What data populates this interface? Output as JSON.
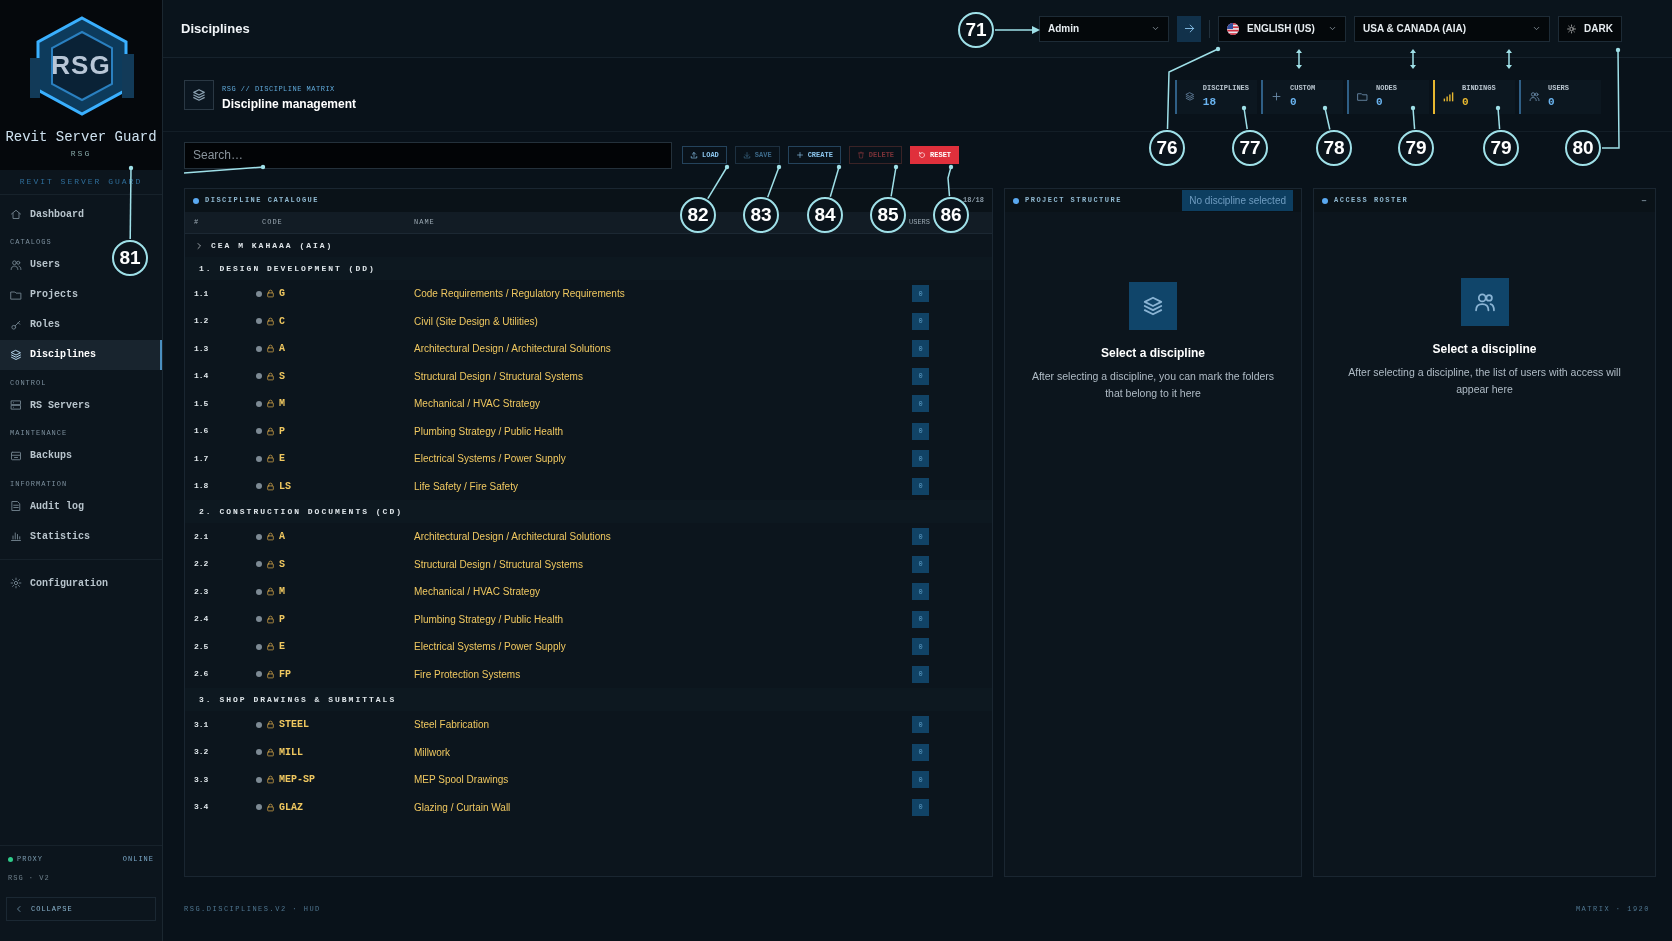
{
  "sidebar": {
    "logo": {
      "mark": "RSG",
      "title": "Revit Server Guard",
      "subtitle": "RSG"
    },
    "brand": "REVIT SERVER GUARD",
    "sections": [
      {
        "items": [
          {
            "label": "Dashboard",
            "selected": false
          }
        ]
      },
      {
        "heading": "CATALOGS",
        "items": [
          {
            "label": "Users",
            "selected": false
          },
          {
            "label": "Projects",
            "selected": false
          },
          {
            "label": "Roles",
            "selected": false
          },
          {
            "label": "Disciplines",
            "selected": true
          }
        ]
      },
      {
        "heading": "CONTROL",
        "items": [
          {
            "label": "RS Servers",
            "selected": false
          }
        ]
      },
      {
        "heading": "MAINTENANCE",
        "items": [
          {
            "label": "Backups",
            "selected": false
          }
        ]
      },
      {
        "heading": "INFORMATION",
        "items": [
          {
            "label": "Audit log",
            "selected": false
          },
          {
            "label": "Statistics",
            "selected": false
          }
        ]
      },
      {
        "items": [
          {
            "label": "Configuration",
            "selected": false
          }
        ]
      }
    ],
    "status": {
      "label": "PROXY",
      "value": "ONLINE",
      "online": true
    },
    "version": "RSG · V2",
    "collapse": "COLLAPSE"
  },
  "header": {
    "title": "Disciplines",
    "user_select": "Admin",
    "language": "ENGLISH (US)",
    "region": "USA & CANADA (AIA)",
    "theme": "DARK"
  },
  "page": {
    "breadcrumb": "RSG // DISCIPLINE MATRIX",
    "title": "Discipline management",
    "stats": [
      {
        "label": "DISCIPLINES",
        "value": "18",
        "color": "#6ab4f0"
      },
      {
        "label": "CUSTOM",
        "value": "0",
        "color": "#6ab4f0"
      },
      {
        "label": "NODES",
        "value": "0",
        "color": "#6ab4f0"
      },
      {
        "label": "BINDINGS",
        "value": "0",
        "color": "#e8b830"
      },
      {
        "label": "USERS",
        "value": "0",
        "color": "#6ab4f0"
      }
    ]
  },
  "toolbar": {
    "search": {
      "placeholder": "Search…"
    },
    "buttons": [
      {
        "label": "LOAD",
        "kind": "outline",
        "disabled": false
      },
      {
        "label": "SAVE",
        "kind": "outline",
        "disabled": true
      },
      {
        "label": "CREATE",
        "kind": "outline",
        "disabled": false
      },
      {
        "label": "DELETE",
        "kind": "danger",
        "disabled": true
      },
      {
        "label": "RESET",
        "kind": "danger-solid",
        "disabled": false
      }
    ]
  },
  "catalogue": {
    "title": "DISCIPLINE CATALOGUE",
    "count": "18/18",
    "columns": [
      "#",
      "CODE",
      "NAME",
      "USERS"
    ],
    "tree": [
      {
        "label": "CEA M KAHAAA (AIA)",
        "children": [
          {
            "label": "1. DESIGN DEVELOPMENT (DD)",
            "children": [
              {
                "number": "1.1",
                "code": "G",
                "name": "Code Requirements / Regulatory Requirements",
                "users": "0"
              },
              {
                "number": "1.2",
                "code": "C",
                "name": "Civil (Site Design & Utilities)",
                "users": "0"
              },
              {
                "number": "1.3",
                "code": "A",
                "name": "Architectural Design / Architectural Solutions",
                "users": "0"
              },
              {
                "number": "1.4",
                "code": "S",
                "name": "Structural Design / Structural Systems",
                "users": "0"
              },
              {
                "number": "1.5",
                "code": "M",
                "name": "Mechanical / HVAC Strategy",
                "users": "0"
              },
              {
                "number": "1.6",
                "code": "P",
                "name": "Plumbing Strategy / Public Health",
                "users": "0"
              },
              {
                "number": "1.7",
                "code": "E",
                "name": "Electrical Systems / Power Supply",
                "users": "0"
              },
              {
                "number": "1.8",
                "code": "LS",
                "name": "Life Safety / Fire Safety",
                "users": "0"
              }
            ]
          },
          {
            "label": "2. CONSTRUCTION DOCUMENTS (CD)",
            "children": [
              {
                "number": "2.1",
                "code": "A",
                "name": "Architectural Design / Architectural Solutions",
                "users": "0"
              },
              {
                "number": "2.2",
                "code": "S",
                "name": "Structural Design / Structural Systems",
                "users": "0"
              },
              {
                "number": "2.3",
                "code": "M",
                "name": "Mechanical / HVAC Strategy",
                "users": "0"
              },
              {
                "number": "2.4",
                "code": "P",
                "name": "Plumbing Strategy / Public Health",
                "users": "0"
              },
              {
                "number": "2.5",
                "code": "E",
                "name": "Electrical Systems / Power Supply",
                "users": "0"
              },
              {
                "number": "2.6",
                "code": "FP",
                "name": "Fire Protection Systems",
                "users": "0"
              }
            ]
          },
          {
            "label": "3. SHOP DRAWINGS & SUBMITTALS",
            "children": [
              {
                "number": "3.1",
                "code": "STEEL",
                "name": "Steel Fabrication",
                "users": "0"
              },
              {
                "number": "3.2",
                "code": "MILL",
                "name": "Millwork",
                "users": "0"
              },
              {
                "number": "3.3",
                "code": "MEP-SP",
                "name": "MEP Spool Drawings",
                "users": "0"
              },
              {
                "number": "3.4",
                "code": "GLAZ",
                "name": "Glazing / Curtain Wall",
                "users": "0"
              }
            ]
          }
        ]
      }
    ]
  },
  "project_structure": {
    "title": "PROJECT STRUCTURE",
    "badge": "No discipline selected",
    "empty_title": "Select a discipline",
    "empty_text": "After selecting a discipline, you can mark the folders that belong to it here"
  },
  "access_roster": {
    "title": "ACCESS ROSTER",
    "action": "–",
    "empty_title": "Select a discipline",
    "empty_text": "After selecting a discipline, the list of users with access will appear here"
  },
  "footer": {
    "left": "RSG.DISCIPLINES.V2 · HUD",
    "right": "MATRIX · 1920"
  },
  "callouts": [
    {
      "label": "71"
    },
    {
      "label": "76"
    },
    {
      "label": "77"
    },
    {
      "label": "78"
    },
    {
      "label": "79"
    },
    {
      "label": "79"
    },
    {
      "label": "80"
    },
    {
      "label": "81"
    },
    {
      "label": "82"
    },
    {
      "label": "83"
    },
    {
      "label": "84"
    },
    {
      "label": "85"
    },
    {
      "label": "86"
    }
  ]
}
